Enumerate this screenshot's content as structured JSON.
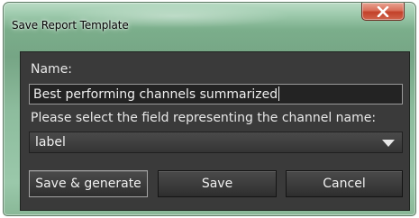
{
  "window": {
    "title": "Save Report Template",
    "close_icon": "close-x-icon"
  },
  "form": {
    "name_label": "Name:",
    "name_value": "Best performing channels summarized",
    "field_label": "Please select the field representing the channel name:",
    "field_selected": "label"
  },
  "buttons": {
    "save_generate": "Save & generate",
    "save": "Save",
    "cancel": "Cancel"
  },
  "colors": {
    "frame": "#7bae8b",
    "close_button": "#c3412a",
    "client_background": "#3a3a3a",
    "text": "#e8e8e8"
  }
}
